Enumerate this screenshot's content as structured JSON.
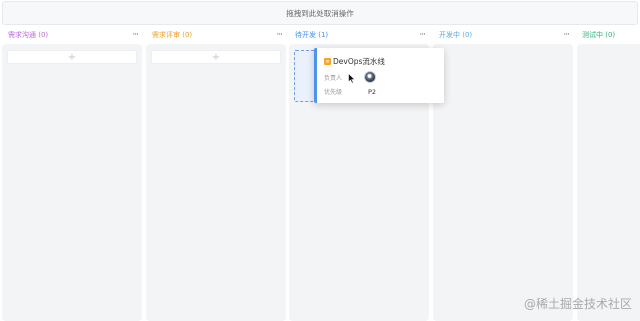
{
  "drop_zone": {
    "label": "拖拽到此处取消操作"
  },
  "columns": [
    {
      "title": "需求沟通 (0)",
      "color": "#b86bd8",
      "more": "···",
      "add": "+"
    },
    {
      "title": "需求评审 (0)",
      "color": "#f0a02c",
      "more": "···",
      "add": "+"
    },
    {
      "title": "待开发 (1)",
      "color": "#3f8cff",
      "more": "···"
    },
    {
      "title": "开发中 (0)",
      "color": "#5aa7e8",
      "more": "···"
    },
    {
      "title": "测试中 (0)",
      "color": "#2db67a"
    }
  ],
  "dragging_card": {
    "title": "DevOps流水线",
    "assignee_label": "负责人",
    "priority_label": "优先级",
    "priority_value": "P2",
    "accent": "#4f93ea",
    "icon": "task-icon"
  },
  "watermark": "@稀土掘金技术社区"
}
